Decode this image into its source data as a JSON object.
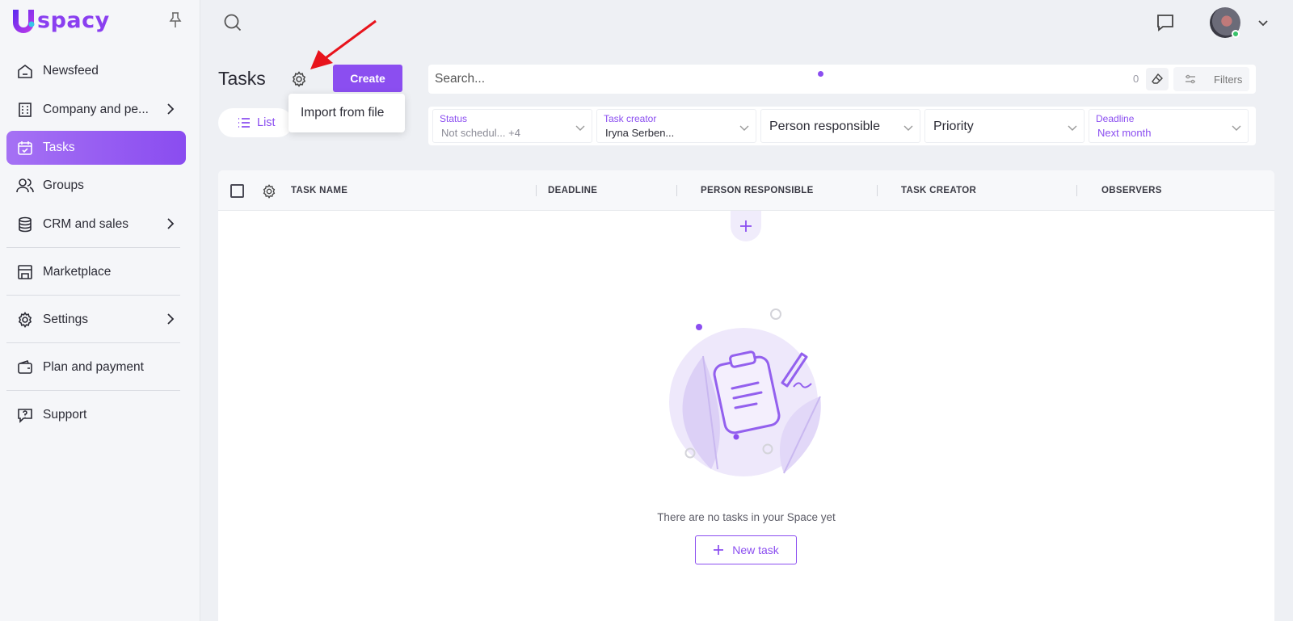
{
  "brand": {
    "name": "spacy",
    "accent": "#8b4ef0"
  },
  "sidebar": {
    "items": [
      {
        "label": "Newsfeed",
        "icon": "house-icon"
      },
      {
        "label": "Company and pe...",
        "icon": "building-icon"
      },
      {
        "label": "Tasks",
        "icon": "calendar-check-icon",
        "active": true
      },
      {
        "label": "Groups",
        "icon": "users-icon"
      },
      {
        "label": "CRM and sales",
        "icon": "database-icon"
      },
      {
        "label": "Marketplace",
        "icon": "store-icon"
      },
      {
        "label": "Settings",
        "icon": "gear-icon"
      },
      {
        "label": "Plan and payment",
        "icon": "wallet-icon"
      },
      {
        "label": "Support",
        "icon": "help-chat-icon"
      }
    ]
  },
  "header": {
    "title": "Tasks",
    "create_label": "Create",
    "view_label": "List"
  },
  "menu": {
    "import_label": "Import from file"
  },
  "search": {
    "placeholder": "Search...",
    "count": "0",
    "filters_label": "Filters"
  },
  "filters": [
    {
      "label": "Status",
      "value": "Not schedul...  +4"
    },
    {
      "label": "Task creator",
      "value": "Iryna Serben..."
    },
    {
      "label": "",
      "value": "Person responsible"
    },
    {
      "label": "",
      "value": "Priority"
    },
    {
      "label": "Deadline",
      "value": "Next month"
    }
  ],
  "table": {
    "columns": [
      "TASK NAME",
      "DEADLINE",
      "PERSON RESPONSIBLE",
      "TASK CREATOR",
      "OBSERVERS"
    ]
  },
  "empty_state": {
    "text": "There are no tasks in your Space yet",
    "button_label": "New task"
  }
}
